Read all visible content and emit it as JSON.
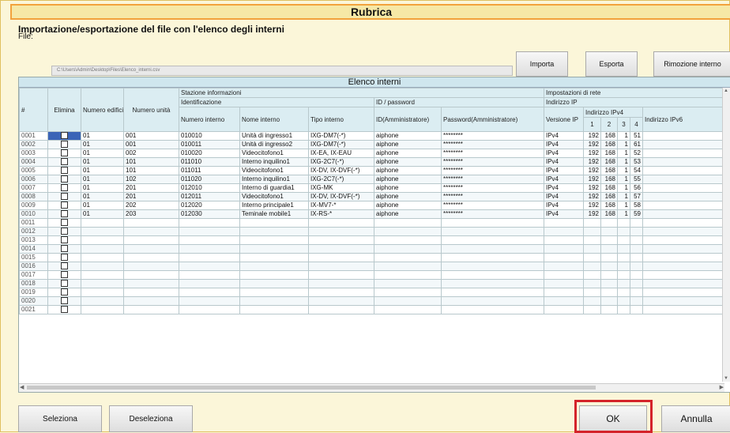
{
  "window": {
    "title": "Rubrica"
  },
  "section": {
    "title": "Importazione/esportazione del file con l'elenco degli interni",
    "file_label": "File:",
    "file_value": "C:\\Users\\Admin\\Desktop\\Files\\Elenco_interni.csv"
  },
  "top_buttons": {
    "import_label": "Importa",
    "export_label": "Esporta",
    "remove_label": "Rimozione interno"
  },
  "table": {
    "caption": "Elenco interni",
    "headers": {
      "index": "#",
      "delete": "Elimina",
      "building_no": "Numero edificio",
      "unit_no": "Numero unità",
      "station_info": "Stazione informazioni",
      "identification": "Identificazione",
      "id_password": "ID / password",
      "network_settings": "Impostazioni di rete",
      "ip_address": "Indirizzo IP",
      "ipv4_address": "Indirizzo IPv4",
      "extension_no": "Numero interno",
      "extension_name": "Nome interno",
      "extension_type": "Tipo interno",
      "admin_id": "ID(Amministratore)",
      "admin_password": "Password(Amministratore)",
      "ip_version": "Versione IP",
      "oct1": "1",
      "oct2": "2",
      "oct3": "3",
      "oct4": "4",
      "ipv6_address": "Indirizzo IPv6"
    },
    "rows": [
      {
        "idx": "0001",
        "building": "01",
        "unit": "001",
        "ext_no": "010010",
        "name": "Unità di ingresso1",
        "type": "IXG-DM7(-*)",
        "id": "aiphone",
        "pwd": "********",
        "ipver": "IPv4",
        "o1": "192",
        "o2": "168",
        "o3": "1",
        "o4": "51",
        "ipv6": ""
      },
      {
        "idx": "0002",
        "building": "01",
        "unit": "001",
        "ext_no": "010011",
        "name": "Unità di ingresso2",
        "type": "IXG-DM7(-*)",
        "id": "aiphone",
        "pwd": "********",
        "ipver": "IPv4",
        "o1": "192",
        "o2": "168",
        "o3": "1",
        "o4": "61",
        "ipv6": ""
      },
      {
        "idx": "0003",
        "building": "01",
        "unit": "002",
        "ext_no": "010020",
        "name": "Videocitofono1",
        "type": "IX-EA, IX-EAU",
        "id": "aiphone",
        "pwd": "********",
        "ipver": "IPv4",
        "o1": "192",
        "o2": "168",
        "o3": "1",
        "o4": "52",
        "ipv6": ""
      },
      {
        "idx": "0004",
        "building": "01",
        "unit": "101",
        "ext_no": "011010",
        "name": "Interno inquilino1",
        "type": "IXG-2C7(-*)",
        "id": "aiphone",
        "pwd": "********",
        "ipver": "IPv4",
        "o1": "192",
        "o2": "168",
        "o3": "1",
        "o4": "53",
        "ipv6": ""
      },
      {
        "idx": "0005",
        "building": "01",
        "unit": "101",
        "ext_no": "011011",
        "name": "Videocitofono1",
        "type": "IX-DV, IX-DVF(-*)",
        "id": "aiphone",
        "pwd": "********",
        "ipver": "IPv4",
        "o1": "192",
        "o2": "168",
        "o3": "1",
        "o4": "54",
        "ipv6": ""
      },
      {
        "idx": "0006",
        "building": "01",
        "unit": "102",
        "ext_no": "011020",
        "name": "Interno inquilino1",
        "type": "IXG-2C7(-*)",
        "id": "aiphone",
        "pwd": "********",
        "ipver": "IPv4",
        "o1": "192",
        "o2": "168",
        "o3": "1",
        "o4": "55",
        "ipv6": ""
      },
      {
        "idx": "0007",
        "building": "01",
        "unit": "201",
        "ext_no": "012010",
        "name": "Interno di guardia1",
        "type": "IXG-MK",
        "id": "aiphone",
        "pwd": "********",
        "ipver": "IPv4",
        "o1": "192",
        "o2": "168",
        "o3": "1",
        "o4": "56",
        "ipv6": ""
      },
      {
        "idx": "0008",
        "building": "01",
        "unit": "201",
        "ext_no": "012011",
        "name": "Videocitofono1",
        "type": "IX-DV, IX-DVF(-*)",
        "id": "aiphone",
        "pwd": "********",
        "ipver": "IPv4",
        "o1": "192",
        "o2": "168",
        "o3": "1",
        "o4": "57",
        "ipv6": ""
      },
      {
        "idx": "0009",
        "building": "01",
        "unit": "202",
        "ext_no": "012020",
        "name": "Interno principale1",
        "type": "IX-MV7-*",
        "id": "aiphone",
        "pwd": "********",
        "ipver": "IPv4",
        "o1": "192",
        "o2": "168",
        "o3": "1",
        "o4": "58",
        "ipv6": ""
      },
      {
        "idx": "0010",
        "building": "01",
        "unit": "203",
        "ext_no": "012030",
        "name": "Teminale mobile1",
        "type": "IX-RS-*",
        "id": "aiphone",
        "pwd": "********",
        "ipver": "IPv4",
        "o1": "192",
        "o2": "168",
        "o3": "1",
        "o4": "59",
        "ipv6": ""
      },
      {
        "idx": "0011",
        "building": "",
        "unit": "",
        "ext_no": "",
        "name": "",
        "type": "",
        "id": "",
        "pwd": "",
        "ipver": "",
        "o1": "",
        "o2": "",
        "o3": "",
        "o4": "",
        "ipv6": ""
      },
      {
        "idx": "0012",
        "building": "",
        "unit": "",
        "ext_no": "",
        "name": "",
        "type": "",
        "id": "",
        "pwd": "",
        "ipver": "",
        "o1": "",
        "o2": "",
        "o3": "",
        "o4": "",
        "ipv6": ""
      },
      {
        "idx": "0013",
        "building": "",
        "unit": "",
        "ext_no": "",
        "name": "",
        "type": "",
        "id": "",
        "pwd": "",
        "ipver": "",
        "o1": "",
        "o2": "",
        "o3": "",
        "o4": "",
        "ipv6": ""
      },
      {
        "idx": "0014",
        "building": "",
        "unit": "",
        "ext_no": "",
        "name": "",
        "type": "",
        "id": "",
        "pwd": "",
        "ipver": "",
        "o1": "",
        "o2": "",
        "o3": "",
        "o4": "",
        "ipv6": ""
      },
      {
        "idx": "0015",
        "building": "",
        "unit": "",
        "ext_no": "",
        "name": "",
        "type": "",
        "id": "",
        "pwd": "",
        "ipver": "",
        "o1": "",
        "o2": "",
        "o3": "",
        "o4": "",
        "ipv6": ""
      },
      {
        "idx": "0016",
        "building": "",
        "unit": "",
        "ext_no": "",
        "name": "",
        "type": "",
        "id": "",
        "pwd": "",
        "ipver": "",
        "o1": "",
        "o2": "",
        "o3": "",
        "o4": "",
        "ipv6": ""
      },
      {
        "idx": "0017",
        "building": "",
        "unit": "",
        "ext_no": "",
        "name": "",
        "type": "",
        "id": "",
        "pwd": "",
        "ipver": "",
        "o1": "",
        "o2": "",
        "o3": "",
        "o4": "",
        "ipv6": ""
      },
      {
        "idx": "0018",
        "building": "",
        "unit": "",
        "ext_no": "",
        "name": "",
        "type": "",
        "id": "",
        "pwd": "",
        "ipver": "",
        "o1": "",
        "o2": "",
        "o3": "",
        "o4": "",
        "ipv6": ""
      },
      {
        "idx": "0019",
        "building": "",
        "unit": "",
        "ext_no": "",
        "name": "",
        "type": "",
        "id": "",
        "pwd": "",
        "ipver": "",
        "o1": "",
        "o2": "",
        "o3": "",
        "o4": "",
        "ipv6": ""
      },
      {
        "idx": "0020",
        "building": "",
        "unit": "",
        "ext_no": "",
        "name": "",
        "type": "",
        "id": "",
        "pwd": "",
        "ipver": "",
        "o1": "",
        "o2": "",
        "o3": "",
        "o4": "",
        "ipv6": ""
      },
      {
        "idx": "0021",
        "building": "",
        "unit": "",
        "ext_no": "",
        "name": "",
        "type": "",
        "id": "",
        "pwd": "",
        "ipver": "",
        "o1": "",
        "o2": "",
        "o3": "",
        "o4": "",
        "ipv6": ""
      }
    ],
    "selected_row_index": 0
  },
  "bottom_buttons": {
    "select_label": "Seleziona",
    "deselect_label": "Deseleziona",
    "ok_label": "OK",
    "cancel_label": "Annulla"
  },
  "colors": {
    "highlight": "#d4232a",
    "title_border": "#f2a23c",
    "selection": "#3a64b7"
  },
  "icons": {
    "scroll_up": "chevron-up-icon",
    "scroll_down": "chevron-down-icon",
    "scroll_left": "chevron-left-icon",
    "scroll_right": "chevron-right-icon"
  }
}
